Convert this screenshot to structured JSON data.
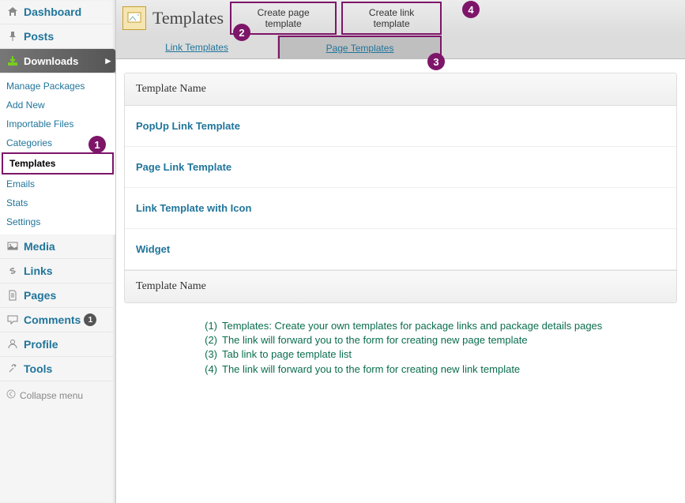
{
  "sidebar": {
    "items": [
      {
        "label": "Dashboard",
        "icon": "home"
      },
      {
        "label": "Posts",
        "icon": "pin"
      },
      {
        "label": "Downloads",
        "icon": "download",
        "active": true
      },
      {
        "label": "Media",
        "icon": "media"
      },
      {
        "label": "Links",
        "icon": "link"
      },
      {
        "label": "Pages",
        "icon": "page"
      },
      {
        "label": "Comments",
        "icon": "comment",
        "badge": "1"
      },
      {
        "label": "Profile",
        "icon": "profile"
      },
      {
        "label": "Tools",
        "icon": "tools"
      }
    ],
    "sub_items": [
      {
        "label": "Manage Packages"
      },
      {
        "label": "Add New"
      },
      {
        "label": "Importable Files"
      },
      {
        "label": "Categories"
      },
      {
        "label": "Templates",
        "selected": true
      },
      {
        "label": "Emails"
      },
      {
        "label": "Stats"
      },
      {
        "label": "Settings"
      }
    ],
    "collapse_label": "Collapse menu"
  },
  "header": {
    "title": "Templates",
    "create_page_label": "Create page template",
    "create_link_label": "Create link template"
  },
  "tabs": {
    "link_templates": "Link Templates",
    "page_templates": "Page Templates"
  },
  "table": {
    "header": "Template Name",
    "footer": "Template Name",
    "rows": [
      "PopUp Link Template",
      "Page Link Template",
      "Link Template with Icon",
      "Widget"
    ]
  },
  "annotations": {
    "b1": "1",
    "b2": "2",
    "b3": "3",
    "b4": "4"
  },
  "legend": [
    {
      "n": "(1)",
      "t": "Templates: Create your own templates for package links and package details pages"
    },
    {
      "n": "(2)",
      "t": "The link will forward you to the form for creating new page template"
    },
    {
      "n": "(3)",
      "t": "Tab link to page template list"
    },
    {
      "n": "(4)",
      "t": "The link will forward you to the form for creating new link template"
    }
  ]
}
